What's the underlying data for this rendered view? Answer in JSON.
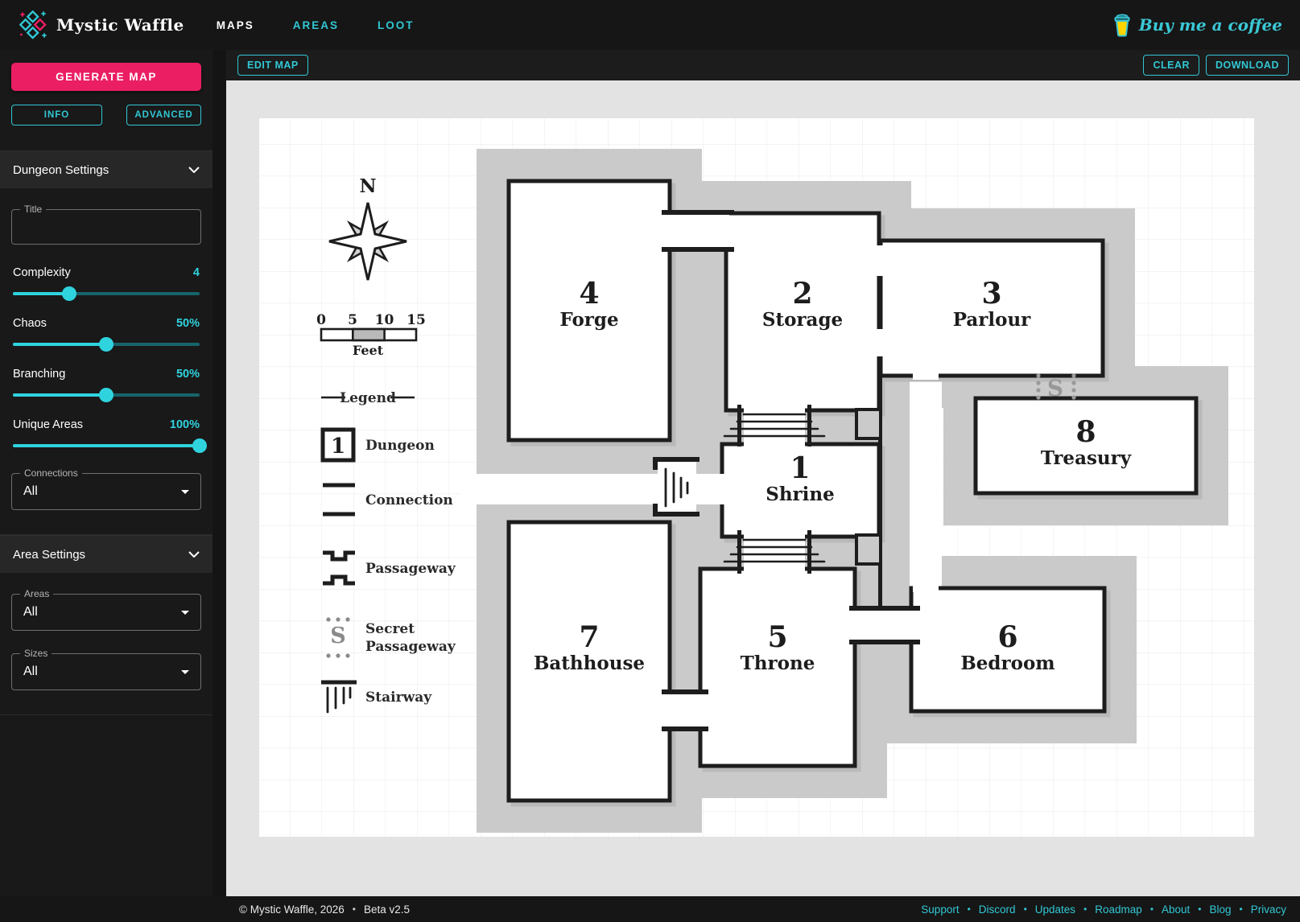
{
  "colors": {
    "teal": "#31c7d4",
    "pink": "#eb1e63",
    "coffee_yellow": "#ffd400",
    "buffer_gray": "#cacaca",
    "wall": "#1d1d1d"
  },
  "navbar": {
    "brand": "Mystic Waffle",
    "items": [
      {
        "label": "MAPS",
        "active": true
      },
      {
        "label": "AREAS",
        "active": false
      },
      {
        "label": "LOOT",
        "active": false
      }
    ],
    "coffee": "Buy me a coffee"
  },
  "toolbar": {
    "edit": "EDIT MAP",
    "clear": "CLEAR",
    "download": "DOWNLOAD"
  },
  "sidebar": {
    "generate": "GENERATE MAP",
    "info": "INFO",
    "advanced": "ADVANCED",
    "dungeon_settings": "Dungeon Settings",
    "title_field": {
      "label": "Title",
      "value": "",
      "placeholder": ""
    },
    "sliders": [
      {
        "label": "Complexity",
        "value": "4",
        "pct": 30
      },
      {
        "label": "Chaos",
        "value": "50%",
        "pct": 50
      },
      {
        "label": "Branching",
        "value": "50%",
        "pct": 50
      },
      {
        "label": "Unique Areas",
        "value": "100%",
        "pct": 100
      }
    ],
    "connections": {
      "label": "Connections",
      "value": "All"
    },
    "area_settings": "Area Settings",
    "areas": {
      "label": "Areas",
      "value": "All"
    },
    "sizes": {
      "label": "Sizes",
      "value": "All"
    }
  },
  "map": {
    "compass_north": "N",
    "scale": {
      "ticks": [
        "0",
        "5",
        "10",
        "15"
      ],
      "unit": "Feet"
    },
    "legend": {
      "title": "Legend",
      "dungeon_icon_number": "1",
      "secret_glyph": "S",
      "items": [
        {
          "label": "Dungeon"
        },
        {
          "label": "Connection"
        },
        {
          "label": "Passageway"
        },
        {
          "label": "Secret",
          "label2": "Passageway"
        },
        {
          "label": "Stairway"
        }
      ]
    },
    "secret_marker": "S",
    "rooms": [
      {
        "num": "1",
        "name": "Shrine"
      },
      {
        "num": "2",
        "name": "Storage"
      },
      {
        "num": "3",
        "name": "Parlour"
      },
      {
        "num": "4",
        "name": "Forge"
      },
      {
        "num": "5",
        "name": "Throne"
      },
      {
        "num": "6",
        "name": "Bedroom"
      },
      {
        "num": "7",
        "name": "Bathhouse"
      },
      {
        "num": "8",
        "name": "Treasury"
      }
    ]
  },
  "footer": {
    "copyright": "© Mystic Waffle, 2026",
    "separator": "•",
    "version": "Beta v2.5",
    "links": [
      "Support",
      "Discord",
      "Updates",
      "Roadmap",
      "About",
      "Blog",
      "Privacy"
    ]
  }
}
